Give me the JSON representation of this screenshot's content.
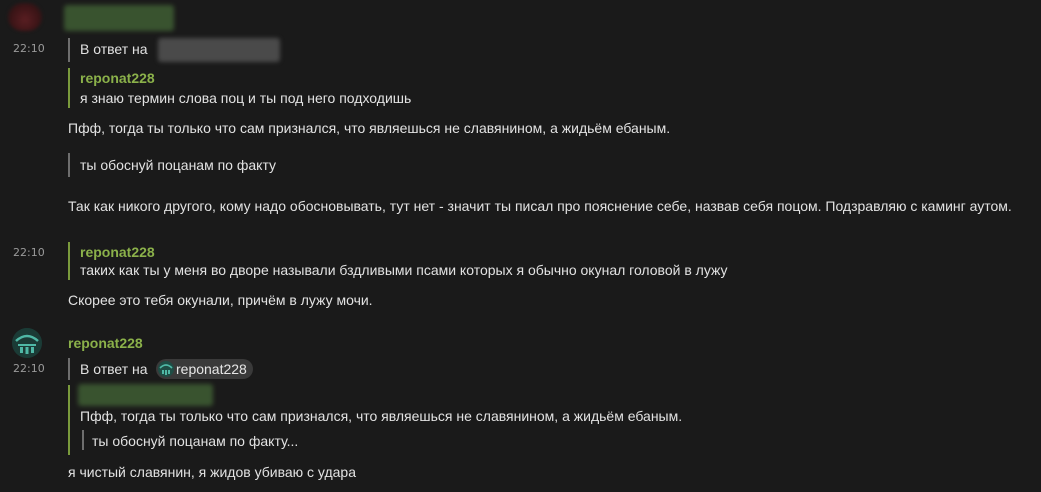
{
  "messages": {
    "first": {
      "time": "22:10",
      "reply_label": "В ответ на",
      "quote1": {
        "author": "reponat228",
        "text": "я знаю термин слова поц и ты под него подходишь"
      },
      "line1": "Пфф, тогда ты только что сам признался, что являешься не славянином, а жидьём ебаным.",
      "quote2": "ты обоснуй поцанам по факту",
      "line2": "Так как никого другого, кому надо обосновывать, тут нет - значит ты писал про пояснение себе, назвав себя поцом. Подзравляю с каминг аутом."
    },
    "second": {
      "time": "22:10",
      "quote": {
        "author": "reponat228",
        "text": "таких как ты у меня во дворе называли бздливыми псами которых я обычно окунал головой в лужу"
      },
      "line": "Скорее это тебя окунали, причём в лужу мочи."
    },
    "third": {
      "author": "reponat228",
      "time": "22:10",
      "reply_label": "В ответ на",
      "reply_user": "reponat228",
      "quote_text": "Пфф, тогда ты только что сам признался, что являешься не славянином, а жидьём ебаным.",
      "nested_quote": "ты обоснуй поцанам по факту...",
      "line": "я чистый славянин, я жидов убиваю с удара"
    }
  },
  "colors": {
    "background": "#1a1a1a",
    "author_green": "#8bb14a",
    "quote_green": "#7a9a3c",
    "text": "#e2e2e2"
  }
}
